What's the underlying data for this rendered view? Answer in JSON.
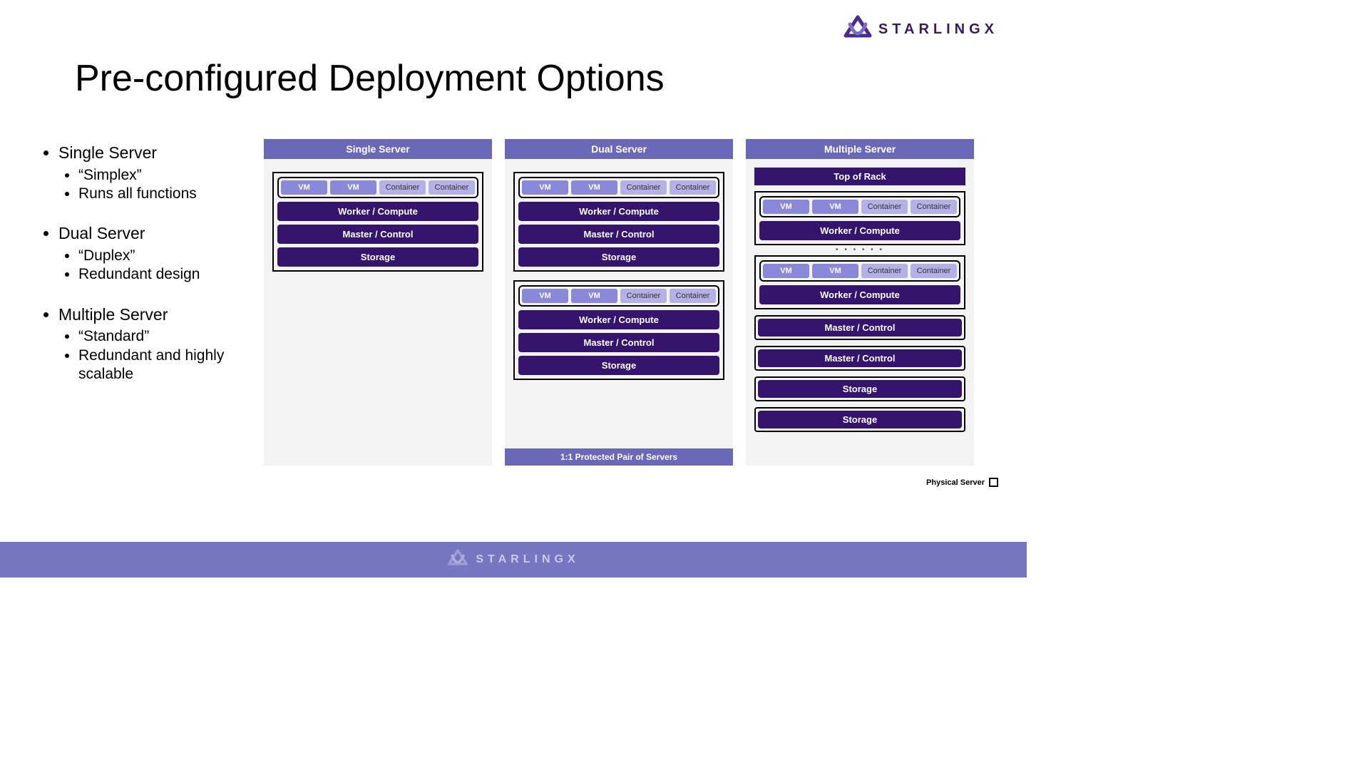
{
  "brand": "STARLINGX",
  "title": "Pre-configured Deployment Options",
  "bullets": [
    {
      "label": "Single Server",
      "sub": [
        "“Simplex”",
        "Runs all functions"
      ]
    },
    {
      "label": "Dual Server",
      "sub": [
        "“Duplex”",
        "Redundant design"
      ]
    },
    {
      "label": "Multiple Server",
      "sub": [
        "“Standard”",
        "Redundant and highly scalable"
      ]
    }
  ],
  "columns": {
    "single": {
      "header": "Single Server",
      "server": {
        "workloads": [
          "VM",
          "VM",
          "Container",
          "Container"
        ],
        "bars": [
          "Worker / Compute",
          "Master / Control",
          "Storage"
        ]
      }
    },
    "dual": {
      "header": "Dual Server",
      "servers": [
        {
          "workloads": [
            "VM",
            "VM",
            "Container",
            "Container"
          ],
          "bars": [
            "Worker / Compute",
            "Master / Control",
            "Storage"
          ]
        },
        {
          "workloads": [
            "VM",
            "VM",
            "Container",
            "Container"
          ],
          "bars": [
            "Worker / Compute",
            "Master / Control",
            "Storage"
          ]
        }
      ],
      "footer": "1:1 Protected Pair of Servers"
    },
    "multi": {
      "header": "Multiple Server",
      "tor": "Top of Rack",
      "compute_servers": [
        {
          "workloads": [
            "VM",
            "VM",
            "Container",
            "Container"
          ],
          "bar": "Worker / Compute"
        },
        {
          "workloads": [
            "VM",
            "VM",
            "Container",
            "Container"
          ],
          "bar": "Worker / Compute"
        }
      ],
      "control_servers": [
        "Master / Control",
        "Master / Control"
      ],
      "storage_servers": [
        "Storage",
        "Storage"
      ]
    }
  },
  "legend": "Physical Server",
  "footer_brand": "STARLINGX"
}
